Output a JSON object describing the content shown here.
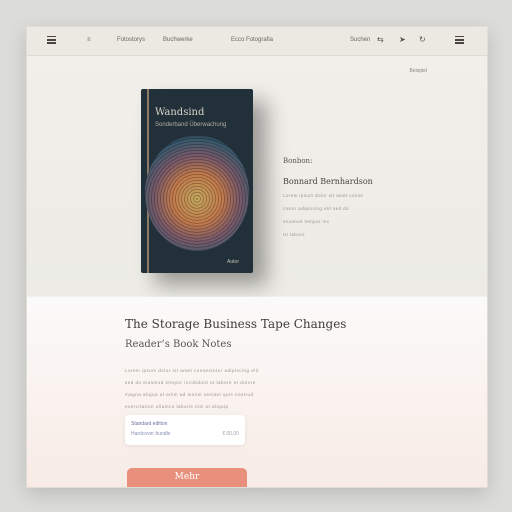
{
  "topbar": {
    "nav_items": [
      "≡",
      "Fotostorys",
      "Buchwerke",
      "Ecco Fotografia"
    ],
    "right_items": [
      "Suchen"
    ],
    "icons": [
      "hamburger-icon",
      "share-icon",
      "send-icon",
      "refresh-icon",
      "menu-icon"
    ]
  },
  "hero": {
    "corner_text": "Beispiel",
    "book": {
      "title": "Wandsind",
      "subtitle": "Sonderband Überwachung",
      "author": "Autor"
    },
    "info": {
      "kicker": "Bonbon:",
      "name": "Bonnard Bernhardson",
      "lines": [
        "Lorem ipsum dolor sit amet conse",
        "ctetur adipiscing elit sed do",
        "eiusmod tempor inc",
        "Ut labore"
      ]
    }
  },
  "lower": {
    "title": "The Storage Business Tape Changes",
    "subtitle": "Reader’s Book Notes",
    "description": [
      "Lorem ipsum dolor sit amet consectetur adipiscing elit",
      "sed do eiusmod tempor incididunt ut labore et dolore",
      "magna aliqua ut enim ad minim veniam quis nostrud",
      "exercitation ullamco laboris nisi ut aliquip"
    ],
    "card": {
      "line1": "Standard edition",
      "line2": "Hardcover bundle",
      "price": "€ 00,00"
    },
    "cta_label": "Mehr"
  }
}
